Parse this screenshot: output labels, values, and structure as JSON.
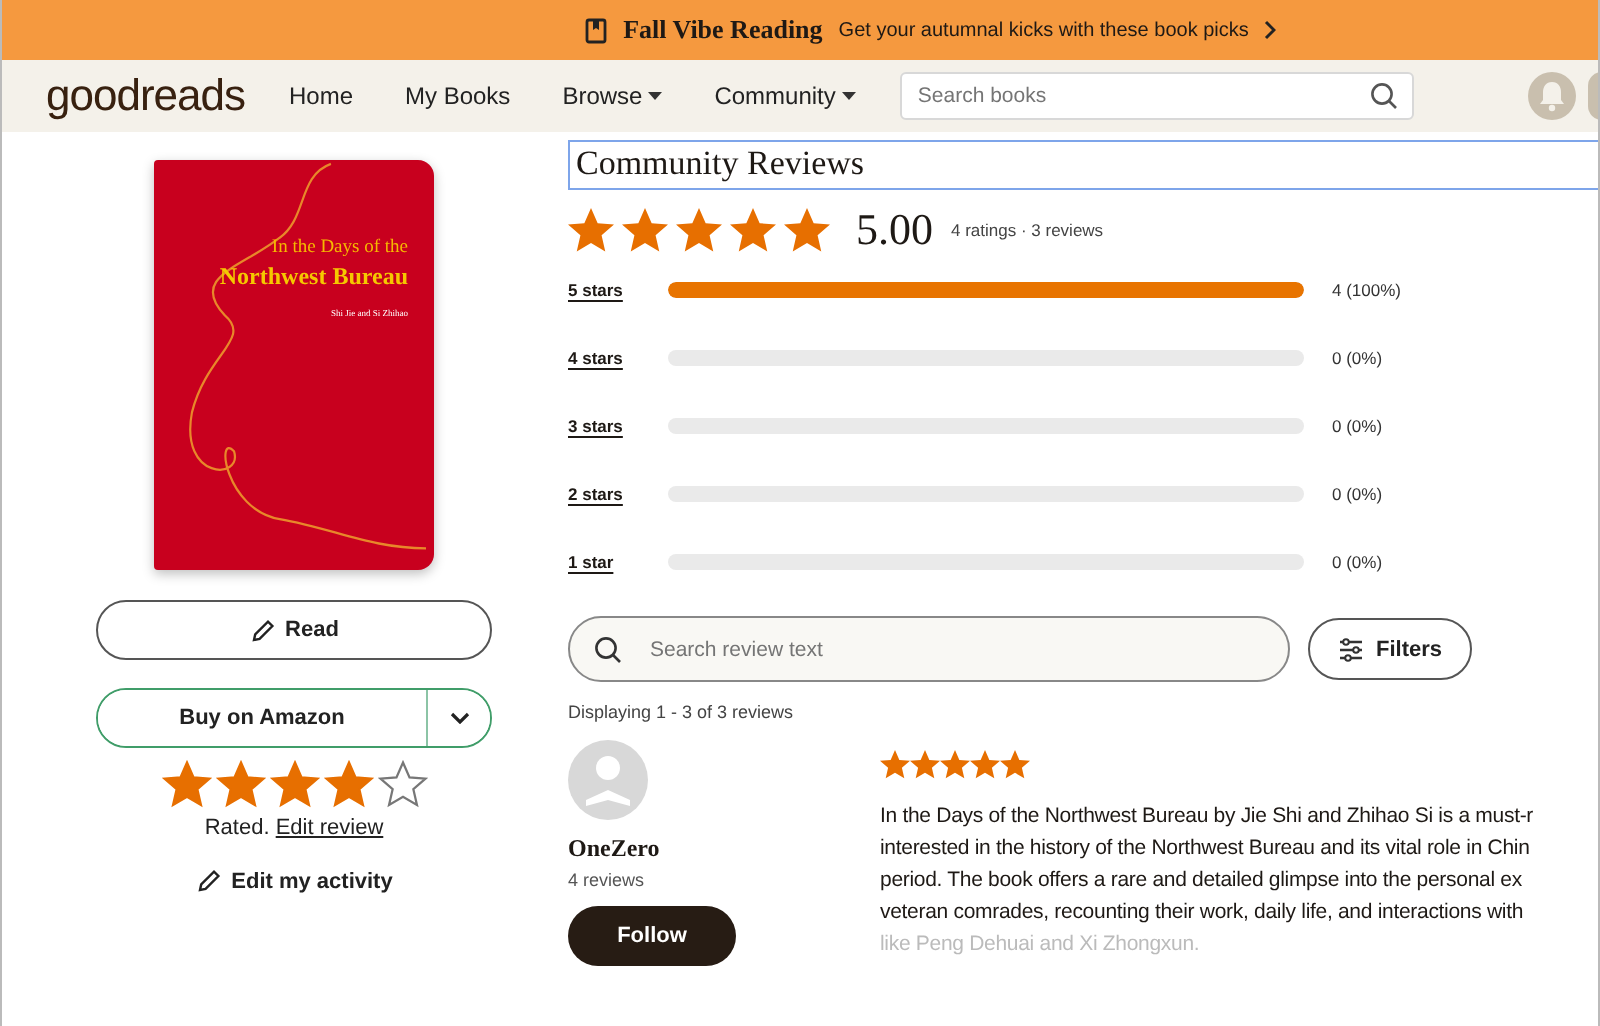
{
  "banner": {
    "title": "Fall Vibe Reading",
    "text": "Get your autumnal kicks with these book picks"
  },
  "nav": {
    "logo": "goodreads",
    "items": [
      {
        "label": "Home",
        "dropdown": false
      },
      {
        "label": "My Books",
        "dropdown": false
      },
      {
        "label": "Browse",
        "dropdown": true
      },
      {
        "label": "Community",
        "dropdown": true
      }
    ],
    "search": {
      "placeholder": "Search books"
    }
  },
  "book": {
    "cover_title_1": "In the Days of the",
    "cover_title_2": "Northwest Bureau",
    "cover_authors": "Shi Jie and Si Zhihao"
  },
  "actions": {
    "read": "Read",
    "buy": "Buy on Amazon",
    "user_rating": {
      "stars": 4
    },
    "rated": "Rated.",
    "edit_review": "Edit review",
    "edit_activity": "Edit my activity"
  },
  "reviews": {
    "title": "Community Reviews",
    "average": {
      "stars": 5
    },
    "score": "5.00",
    "counts": "4 ratings · 3 reviews",
    "histogram": [
      {
        "label": "5 stars",
        "level": 1,
        "reading": "4 (100%)"
      },
      {
        "label": "4 stars",
        "level": 0,
        "reading": "0 (0%)"
      },
      {
        "label": "3 stars",
        "level": 0,
        "reading": "0 (0%)"
      },
      {
        "label": "2 stars",
        "level": 0,
        "reading": "0 (0%)"
      },
      {
        "label": "1 star",
        "level": 0,
        "reading": "0 (0%)"
      }
    ],
    "search": {
      "placeholder": "Search review text"
    },
    "filters": "Filters",
    "displaying": "Displaying 1 - 3 of 3 reviews",
    "items": [
      {
        "name": "OneZero",
        "count": "4 reviews",
        "follow": "Follow",
        "stars": 5,
        "lines": [
          "In the Days of the Northwest Bureau by Jie Shi and Zhihao Si is a must-r",
          "interested in the history of the Northwest Bureau and its vital role in Chin",
          "period. The book offers a rare and detailed glimpse into the personal ex",
          "veteran comrades, recounting their work, daily life, and interactions with",
          "like Peng Dehuai and Xi Zhongxun."
        ]
      }
    ]
  }
}
